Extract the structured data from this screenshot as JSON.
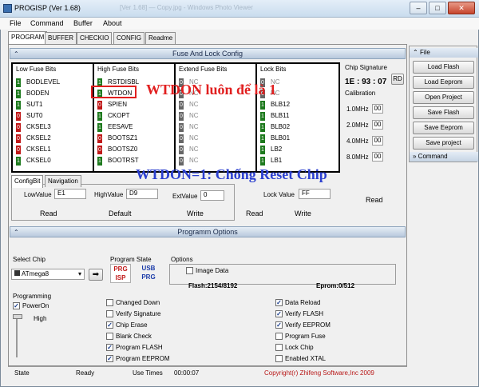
{
  "window": {
    "title": "PROGISP (Ver 1.68)",
    "title_ghost": "[Ver 1.68] — Copy.jpg - Windows Photo Viewer"
  },
  "menu": [
    "File",
    "Command",
    "Buffer",
    "About"
  ],
  "tabs": [
    "PROGRAM",
    "BUFFER",
    "CHECKIO",
    "CONFIG",
    "Readme"
  ],
  "fuse_panel": {
    "title": "Fuse And Lock Config",
    "columns": [
      {
        "header": "Low Fuse Bits",
        "bits": [
          [
            "1",
            "BODLEVEL"
          ],
          [
            "1",
            "BODEN"
          ],
          [
            "1",
            "SUT1"
          ],
          [
            "0",
            "SUT0"
          ],
          [
            "0",
            "CKSEL3"
          ],
          [
            "0",
            "CKSEL2"
          ],
          [
            "0",
            "CKSEL1"
          ],
          [
            "1",
            "CKSEL0"
          ]
        ]
      },
      {
        "header": "High Fuse Bits",
        "bits": [
          [
            "1",
            "RSTDISBL"
          ],
          [
            "1",
            "WTDON"
          ],
          [
            "0",
            "SPIEN"
          ],
          [
            "1",
            "CKOPT"
          ],
          [
            "1",
            "EESAVE"
          ],
          [
            "0",
            "BOOTSZ1"
          ],
          [
            "0",
            "BOOTSZ0"
          ],
          [
            "1",
            "BOOTRST"
          ]
        ]
      },
      {
        "header": "Extend Fuse Bits",
        "bits": [
          [
            "0",
            "NC"
          ],
          [
            "0",
            "NC"
          ],
          [
            "0",
            "NC"
          ],
          [
            "0",
            "NC"
          ],
          [
            "0",
            "NC"
          ],
          [
            "0",
            "NC"
          ],
          [
            "0",
            "NC"
          ],
          [
            "0",
            "NC"
          ]
        ]
      },
      {
        "header": "Lock Bits",
        "bits": [
          [
            "0",
            "NC"
          ],
          [
            "0",
            "NC"
          ],
          [
            "1",
            "BLB12"
          ],
          [
            "1",
            "BLB11"
          ],
          [
            "1",
            "BLB02"
          ],
          [
            "1",
            "BLB01"
          ],
          [
            "1",
            "LB2"
          ],
          [
            "1",
            "LB1"
          ]
        ]
      }
    ],
    "annotation_top": "WTDON luôn để là 1",
    "annotation_mid": "WTDON=1: Chống Reset Chip"
  },
  "chip_signature": {
    "label": "Chip Signature",
    "value": "1E : 93 : 07",
    "rd_button": "RD"
  },
  "calibration": {
    "label": "Calibration",
    "items": [
      [
        "1.0MHz",
        "00"
      ],
      [
        "2.0MHz",
        "00"
      ],
      [
        "4.0MHz",
        "00"
      ],
      [
        "8.0MHz",
        "00"
      ]
    ],
    "read_button": "Read"
  },
  "config_tabs": [
    "ConfigBit",
    "Navigation"
  ],
  "fuse_values": {
    "low_label": "LowValue",
    "low_value": "E1",
    "high_label": "HighValue",
    "high_value": "D9",
    "ext_label": "ExtValue",
    "ext_value": "0",
    "lock_label": "Lock Value",
    "lock_value": "FF"
  },
  "fuse_buttons": {
    "read": "Read",
    "default": "Default",
    "write": "Write",
    "lock_read": "Read",
    "lock_write": "Write"
  },
  "right_panel": {
    "file_label": "File",
    "buttons": [
      "Load Flash",
      "Load Eeprom",
      "Open Project",
      "Save Flash",
      "Save Eeprom",
      "Save project"
    ],
    "command_label": "Command"
  },
  "program_options": {
    "title": "Programm Options",
    "select_chip_label": "Select Chip",
    "chip": "ATmega8",
    "program_state_label": "Program State",
    "options_label": "Options",
    "image_data": "Image Data",
    "flash_info": "Flash:2154/8192",
    "eprom_info": "Eprom:0/512",
    "programming_label": "Programming",
    "power_on": "PowerOn",
    "speed": "High",
    "checks_left": [
      [
        "Changed Down",
        false
      ],
      [
        "Verify Signature",
        false
      ],
      [
        "Chip Erase",
        true
      ],
      [
        "Blank Check",
        false
      ],
      [
        "Program FLASH",
        true
      ],
      [
        "Program EEPROM",
        true
      ]
    ],
    "checks_right": [
      [
        "Data Reload",
        true
      ],
      [
        "Verify FLASH",
        true
      ],
      [
        "Verify EEPROM",
        true
      ],
      [
        "Program Fuse",
        false
      ],
      [
        "Lock Chip",
        false
      ],
      [
        "Enabled XTAL",
        false
      ]
    ],
    "usb_prg": "USB PRG",
    "prg_isp": "PRG ISP"
  },
  "status": {
    "state_label": "State",
    "state": "Ready",
    "time_label": "Use Times",
    "time": "00:00:07",
    "copyright": "Copyright(r) Zhifeng Software,Inc 2009"
  },
  "colors": {
    "annotation_red": "#e11f1f",
    "annotation_blue": "#2b3fcf",
    "copyright_red": "#b81818"
  }
}
